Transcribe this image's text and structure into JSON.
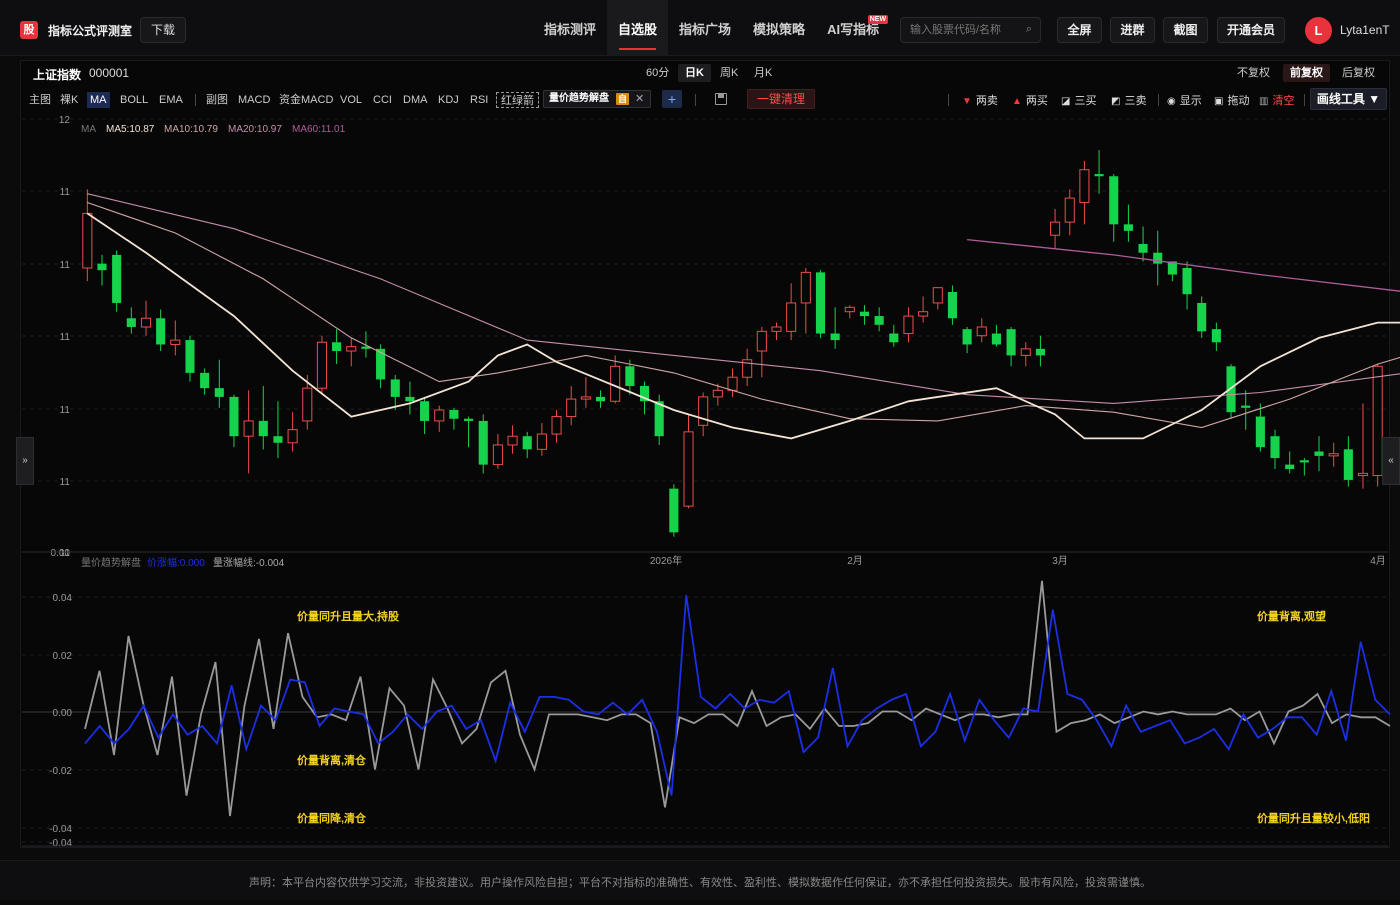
{
  "header": {
    "logo_char": "股",
    "brand": "指标公式评测室",
    "download_label": "下载",
    "nav": [
      {
        "label": "指标测评",
        "active": false
      },
      {
        "label": "自选股",
        "active": true
      },
      {
        "label": "指标广场",
        "active": false
      },
      {
        "label": "模拟策略",
        "active": false
      },
      {
        "label": "AI写指标",
        "active": false,
        "badge": "NEW"
      }
    ],
    "search_placeholder": "输入股票代码/名称",
    "fullscreen_label": "全屏",
    "join_group_label": "进群",
    "screenshot_label": "截图",
    "vip_label": "开通会员",
    "avatar_letter": "L",
    "username": "Lyta1enT"
  },
  "symbol": {
    "name": "上证指数",
    "code": "000001"
  },
  "periods": [
    {
      "label": "60分",
      "active": false
    },
    {
      "label": "日K",
      "active": true
    },
    {
      "label": "周K",
      "active": false
    },
    {
      "label": "月K",
      "active": false
    }
  ],
  "adjust": [
    {
      "label": "不复权",
      "active": false
    },
    {
      "label": "前复权",
      "active": true
    },
    {
      "label": "后复权",
      "active": false
    }
  ],
  "toolbar": {
    "main_label": "主图",
    "bare_k_label": "裸K",
    "ma_label": "MA",
    "boll_label": "BOLL",
    "ema_label": "EMA",
    "sub_label": "副图",
    "macd_label": "MACD",
    "fund_macd_label": "资金MACD",
    "vol_label": "VOL",
    "cci_label": "CCI",
    "dma_label": "DMA",
    "kdj_label": "KDJ",
    "rsi_label": "RSI",
    "red_green_label": "红绿箭",
    "indicator_chip": "量价趋势解盘",
    "indicator_tag": "自",
    "clear_label": "一键清理",
    "sig_sell2": "两卖",
    "sig_buy2": "两买",
    "sig_buy3": "三买",
    "sig_sell3": "三卖",
    "show_label": "显示",
    "drag_label": "拖动",
    "clear_all_label": "清空",
    "draw_tool_label": "画线工具 ▼"
  },
  "colors": {
    "up": "#ef4b4b",
    "down": "#17d34b",
    "ma5": "#f3e3d3",
    "ma10": "#cfa6a6",
    "ma20": "#c68ea8",
    "ma60": "#b05c99",
    "price_change": "#1b2fe6",
    "volume_change": "#9a9a9a",
    "annotation": "#f2d21b"
  },
  "main_chart": {
    "legend": [
      {
        "text": "MA",
        "key": "muted"
      },
      {
        "text": "MA5:10.87",
        "key": "ma5"
      },
      {
        "text": "MA10:10.79",
        "key": "ma10"
      },
      {
        "text": "MA20:10.97",
        "key": "ma20"
      },
      {
        "text": "MA60:11.01",
        "key": "ma60"
      }
    ],
    "y_ticks": [
      "12",
      "11",
      "11",
      "11",
      "11",
      "11",
      "11",
      "0.00"
    ],
    "x_ticks": [
      "2026年",
      "2月",
      "3月",
      "4月"
    ],
    "candles": [
      [
        11.3,
        11.55,
        11.24,
        11.66
      ],
      [
        11.32,
        11.29,
        11.22,
        11.36
      ],
      [
        11.36,
        11.14,
        11.1,
        11.38
      ],
      [
        11.07,
        11.03,
        11.0,
        11.12
      ],
      [
        11.03,
        11.07,
        10.99,
        11.15
      ],
      [
        11.07,
        10.95,
        10.92,
        11.11
      ],
      [
        10.95,
        10.97,
        10.9,
        11.06
      ],
      [
        10.97,
        10.82,
        10.78,
        10.99
      ],
      [
        10.82,
        10.75,
        10.72,
        10.84
      ],
      [
        10.75,
        10.71,
        10.66,
        10.88
      ],
      [
        10.71,
        10.53,
        10.48,
        10.72
      ],
      [
        10.53,
        10.6,
        10.36,
        10.74
      ],
      [
        10.6,
        10.53,
        10.47,
        10.76
      ],
      [
        10.53,
        10.5,
        10.43,
        10.69
      ],
      [
        10.5,
        10.56,
        10.46,
        10.64
      ],
      [
        10.6,
        10.75,
        10.56,
        10.81
      ],
      [
        10.75,
        10.96,
        10.72,
        10.99
      ],
      [
        10.96,
        10.92,
        10.86,
        11.02
      ],
      [
        10.92,
        10.94,
        10.85,
        10.98
      ],
      [
        10.94,
        10.93,
        10.89,
        11.01
      ],
      [
        10.93,
        10.79,
        10.75,
        10.95
      ],
      [
        10.79,
        10.71,
        10.65,
        10.81
      ],
      [
        10.71,
        10.69,
        10.63,
        10.78
      ],
      [
        10.69,
        10.6,
        10.54,
        10.71
      ],
      [
        10.6,
        10.65,
        10.55,
        10.67
      ],
      [
        10.65,
        10.61,
        10.56,
        10.66
      ],
      [
        10.61,
        10.6,
        10.48,
        10.62
      ],
      [
        10.6,
        10.4,
        10.36,
        10.63
      ],
      [
        10.4,
        10.49,
        10.38,
        10.54
      ],
      [
        10.49,
        10.53,
        10.45,
        10.58
      ],
      [
        10.53,
        10.47,
        10.43,
        10.55
      ],
      [
        10.47,
        10.54,
        10.44,
        10.59
      ],
      [
        10.54,
        10.62,
        10.5,
        10.65
      ],
      [
        10.62,
        10.7,
        10.58,
        10.76
      ],
      [
        10.7,
        10.71,
        10.66,
        10.8
      ],
      [
        10.71,
        10.69,
        10.66,
        10.74
      ],
      [
        10.69,
        10.85,
        10.68,
        10.9
      ],
      [
        10.85,
        10.76,
        10.72,
        10.88
      ],
      [
        10.76,
        10.69,
        10.63,
        10.78
      ],
      [
        10.69,
        10.53,
        10.49,
        10.72
      ],
      [
        10.29,
        10.09,
        10.07,
        10.31
      ],
      [
        10.21,
        10.55,
        10.2,
        10.63
      ],
      [
        10.58,
        10.71,
        10.53,
        10.73
      ],
      [
        10.71,
        10.74,
        10.67,
        10.77
      ],
      [
        10.74,
        10.8,
        10.71,
        10.84
      ],
      [
        10.8,
        10.88,
        10.76,
        10.93
      ],
      [
        10.92,
        11.01,
        10.8,
        11.03
      ],
      [
        11.01,
        11.03,
        10.97,
        11.05
      ],
      [
        11.01,
        11.14,
        10.97,
        11.23
      ],
      [
        11.14,
        11.28,
        11.0,
        11.3
      ],
      [
        11.28,
        11.0,
        10.98,
        11.29
      ],
      [
        11.0,
        10.97,
        10.93,
        11.12
      ],
      [
        11.1,
        11.12,
        11.07,
        11.13
      ],
      [
        11.1,
        11.08,
        11.04,
        11.13
      ],
      [
        11.08,
        11.04,
        11.01,
        11.12
      ],
      [
        11.0,
        10.96,
        10.94,
        11.04
      ],
      [
        11.0,
        11.08,
        10.96,
        11.12
      ],
      [
        11.08,
        11.1,
        11.05,
        11.17
      ],
      [
        11.14,
        11.21,
        11.11,
        11.21
      ],
      [
        11.19,
        11.07,
        11.04,
        11.22
      ],
      [
        11.02,
        10.95,
        10.91,
        11.03
      ],
      [
        10.99,
        11.03,
        10.96,
        11.07
      ],
      [
        11.0,
        10.95,
        10.94,
        11.04
      ],
      [
        11.02,
        10.9,
        10.85,
        11.03
      ],
      [
        10.9,
        10.93,
        10.85,
        10.96
      ],
      [
        10.93,
        10.9,
        10.85,
        10.99
      ],
      [
        11.45,
        11.51,
        11.39,
        11.57
      ],
      [
        11.51,
        11.62,
        11.45,
        11.66
      ],
      [
        11.6,
        11.75,
        11.5,
        11.79
      ],
      [
        11.73,
        11.72,
        11.64,
        11.84
      ],
      [
        11.72,
        11.5,
        11.42,
        11.73
      ],
      [
        11.5,
        11.47,
        11.42,
        11.59
      ],
      [
        11.41,
        11.37,
        11.33,
        11.49
      ],
      [
        11.37,
        11.32,
        11.22,
        11.47
      ],
      [
        11.33,
        11.27,
        11.24,
        11.33
      ],
      [
        11.3,
        11.18,
        11.11,
        11.33
      ],
      [
        11.14,
        11.01,
        10.98,
        11.17
      ],
      [
        11.02,
        10.96,
        10.92,
        11.05
      ],
      [
        10.85,
        10.64,
        10.61,
        10.86
      ],
      [
        10.67,
        10.66,
        10.56,
        10.74
      ],
      [
        10.62,
        10.48,
        10.46,
        10.68
      ],
      [
        10.53,
        10.43,
        10.38,
        10.56
      ],
      [
        10.4,
        10.38,
        10.36,
        10.46
      ],
      [
        10.42,
        10.41,
        10.35,
        10.43
      ],
      [
        10.46,
        10.44,
        10.37,
        10.53
      ],
      [
        10.44,
        10.45,
        10.39,
        10.5
      ],
      [
        10.47,
        10.33,
        10.3,
        10.53
      ],
      [
        10.35,
        10.36,
        10.29,
        10.68
      ],
      [
        10.35,
        10.85,
        10.3,
        10.86
      ]
    ],
    "ma5": [
      [
        0,
        11.55
      ],
      [
        4,
        11.37
      ],
      [
        10,
        11.08
      ],
      [
        14,
        10.83
      ],
      [
        18,
        10.62
      ],
      [
        22,
        10.68
      ],
      [
        26,
        10.78
      ],
      [
        28,
        10.9
      ],
      [
        30,
        10.95
      ],
      [
        32,
        10.87
      ],
      [
        36,
        10.76
      ],
      [
        40,
        10.65
      ],
      [
        44,
        10.57
      ],
      [
        48,
        10.52
      ],
      [
        52,
        10.6
      ],
      [
        56,
        10.69
      ],
      [
        62,
        10.75
      ],
      [
        66,
        10.63
      ],
      [
        68,
        10.52
      ],
      [
        72,
        10.52
      ],
      [
        76,
        10.65
      ],
      [
        80,
        10.85
      ],
      [
        84,
        10.98
      ],
      [
        88,
        11.05
      ],
      [
        92,
        11.05
      ],
      [
        96,
        11.06
      ],
      [
        100,
        11.04
      ],
      [
        104,
        11.06
      ],
      [
        108,
        11.0
      ],
      [
        114,
        10.96
      ],
      [
        118,
        11.09
      ],
      [
        122,
        11.22
      ],
      [
        124,
        11.35
      ],
      [
        130,
        11.64
      ],
      [
        134,
        11.67
      ],
      [
        138,
        11.56
      ],
      [
        142,
        11.4
      ],
      [
        148,
        11.26
      ],
      [
        152,
        11.07
      ],
      [
        156,
        10.88
      ],
      [
        160,
        10.66
      ],
      [
        164,
        10.5
      ],
      [
        168,
        10.45
      ],
      [
        172,
        10.4
      ],
      [
        174,
        10.5
      ],
      [
        178,
        10.6
      ]
    ],
    "ma10": [
      [
        0,
        11.6
      ],
      [
        6,
        11.46
      ],
      [
        12,
        11.25
      ],
      [
        18,
        10.98
      ],
      [
        24,
        10.78
      ],
      [
        28,
        10.82
      ],
      [
        34,
        10.9
      ],
      [
        40,
        10.82
      ],
      [
        46,
        10.7
      ],
      [
        52,
        10.61
      ],
      [
        58,
        10.6
      ],
      [
        64,
        10.67
      ],
      [
        70,
        10.64
      ],
      [
        76,
        10.57
      ],
      [
        82,
        10.7
      ],
      [
        88,
        10.86
      ],
      [
        94,
        10.98
      ],
      [
        100,
        11.02
      ],
      [
        106,
        11.02
      ],
      [
        112,
        11.01
      ],
      [
        118,
        11.06
      ],
      [
        124,
        11.16
      ],
      [
        130,
        11.28
      ],
      [
        136,
        11.42
      ],
      [
        140,
        11.48
      ],
      [
        146,
        11.36
      ],
      [
        150,
        11.17
      ],
      [
        156,
        10.97
      ],
      [
        160,
        10.77
      ],
      [
        166,
        10.58
      ],
      [
        170,
        10.49
      ],
      [
        174,
        10.46
      ],
      [
        178,
        10.48
      ]
    ],
    "ma20": [
      [
        0,
        11.64
      ],
      [
        10,
        11.48
      ],
      [
        20,
        11.25
      ],
      [
        30,
        10.97
      ],
      [
        40,
        10.9
      ],
      [
        50,
        10.83
      ],
      [
        60,
        10.72
      ],
      [
        70,
        10.68
      ],
      [
        80,
        10.73
      ],
      [
        90,
        10.82
      ],
      [
        96,
        10.93
      ],
      [
        102,
        11.0
      ],
      [
        112,
        11.02
      ],
      [
        118,
        11.04
      ],
      [
        124,
        11.1
      ],
      [
        132,
        11.21
      ],
      [
        136,
        11.31
      ],
      [
        140,
        11.4
      ],
      [
        146,
        11.48
      ],
      [
        150,
        11.38
      ],
      [
        156,
        11.2
      ],
      [
        162,
        11.08
      ],
      [
        166,
        11.02
      ],
      [
        174,
        10.97
      ],
      [
        178,
        10.97
      ]
    ],
    "ma60": [
      [
        60,
        11.43
      ],
      [
        70,
        11.36
      ],
      [
        80,
        11.27
      ],
      [
        90,
        11.19
      ],
      [
        100,
        11.12
      ],
      [
        110,
        11.07
      ],
      [
        118,
        11.03
      ],
      [
        126,
        10.96
      ],
      [
        134,
        10.92
      ],
      [
        140,
        10.88
      ],
      [
        146,
        10.92
      ],
      [
        152,
        10.97
      ],
      [
        158,
        11.02
      ],
      [
        164,
        11.04
      ],
      [
        170,
        11.01
      ],
      [
        178,
        11.01
      ]
    ]
  },
  "sub_chart": {
    "legend": [
      {
        "text": "量价趋势解盘",
        "key": "muted"
      },
      {
        "text": "价涨幅:0.000",
        "key": "price"
      },
      {
        "text": "量涨幅线:-0.004",
        "key": "volume"
      }
    ],
    "y_ticks": [
      "0.04",
      "0.02",
      "0.00",
      "-0.02",
      "-0.04",
      "-0.04"
    ],
    "annotations": [
      {
        "text": "价量同升且量大,持股",
        "pos": "upper-left"
      },
      {
        "text": "价量背离,清仓",
        "pos": "mid-left"
      },
      {
        "text": "价量同降,清仓",
        "pos": "lower-left"
      },
      {
        "text": "价量背离,观望",
        "pos": "upper-right"
      },
      {
        "text": "价量同升且量较小,低阳",
        "pos": "lower-right"
      }
    ],
    "price_change": [
      -0.01,
      -0.004,
      -0.01,
      -0.005,
      0.003,
      -0.008,
      0.0,
      -0.007,
      -0.004,
      -0.01,
      0.01,
      -0.012,
      0.003,
      -0.002,
      0.012,
      0.011,
      -0.004,
      0.002,
      0.001,
      0.0,
      -0.01,
      -0.006,
      0.0,
      -0.005,
      0.001,
      0.003,
      -0.005,
      -0.002,
      -0.016,
      0.004,
      -0.006,
      0.006,
      0.006,
      0.005,
      0.001,
      0.0,
      0.004,
      0.0,
      0.005,
      -0.006,
      -0.028,
      0.041,
      0.006,
      0.002,
      0.007,
      0.002,
      0.005,
      0.004,
      0.008,
      -0.013,
      -0.008,
      0.016,
      -0.011,
      -0.002,
      0.002,
      0.005,
      0.007,
      -0.011,
      -0.006,
      0.007,
      -0.009,
      0.005,
      -0.002,
      -0.008,
      0.002,
      0.001,
      0.036,
      0.007,
      0.005,
      -0.002,
      -0.011,
      0.003,
      -0.006,
      -0.004,
      -0.002,
      -0.01,
      -0.008,
      -0.005,
      -0.012,
      0.0,
      -0.008,
      -0.005,
      -0.001,
      -0.001,
      -0.007,
      0.008,
      -0.009,
      0.025,
      0.005,
      0.0
    ],
    "volume_change": [
      -0.005,
      0.015,
      -0.014,
      0.027,
      0.004,
      -0.014,
      0.013,
      -0.028,
      0.0,
      0.018,
      -0.035,
      0.003,
      0.026,
      -0.005,
      0.028,
      0.006,
      -0.001,
      0.0,
      -0.002,
      0.013,
      -0.019,
      0.009,
      0.003,
      -0.019,
      0.012,
      0.002,
      -0.01,
      -0.005,
      0.011,
      0.015,
      -0.007,
      -0.019,
      0.0,
      0.0,
      0.0,
      -0.001,
      -0.002,
      0.0,
      0.0,
      -0.003,
      -0.032,
      -0.001,
      -0.003,
      0.0,
      0.0,
      -0.004,
      0.008,
      -0.004,
      -0.001,
      0.0,
      -0.005,
      0.002,
      -0.004,
      -0.004,
      -0.003,
      0.001,
      0.001,
      -0.002,
      0.002,
      0.0,
      -0.002,
      0.0,
      0.0,
      -0.001,
      0.0,
      0.0,
      0.046,
      -0.006,
      -0.003,
      -0.002,
      0.0,
      -0.003,
      -0.001,
      0.001,
      0.0,
      0.001,
      0.0,
      0.0,
      0.0,
      0.002,
      -0.002,
      0.001,
      -0.01,
      0.001,
      0.003,
      0.007,
      -0.003,
      0.0,
      -0.001,
      -0.001,
      -0.004
    ]
  },
  "footer": {
    "disclaimer": "声明：本平台内容仅供学习交流，非投资建议。用户操作风险自担；平台不对指标的准确性、有效性、盈利性、模拟数据作任何保证，亦不承担任何投资损失。股市有风险，投资需谨慎。"
  }
}
